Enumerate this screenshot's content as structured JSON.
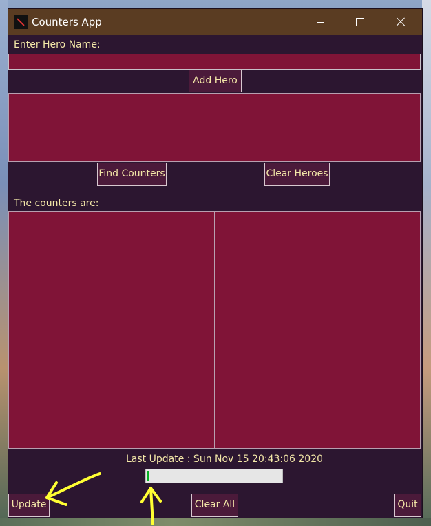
{
  "window": {
    "title": "Counters App"
  },
  "hero_input": {
    "label": "Enter Hero Name:",
    "value": ""
  },
  "buttons": {
    "add_hero": "Add Hero",
    "find_counters": "Find Counters",
    "clear_heroes": "Clear Heroes",
    "update": "Update",
    "clear_all": "Clear All",
    "quit": "Quit"
  },
  "heroes_list": {
    "items": []
  },
  "counters": {
    "label": "The counters are:",
    "left_list": [],
    "right_list": []
  },
  "status": {
    "last_update_text": "Last Update : Sun Nov 15 20:43:06 2020",
    "progress_fraction": 0.01
  },
  "colors": {
    "titlebar": "#5a3c22",
    "background": "#2c1630",
    "list_bg": "#801437",
    "text": "#f3e7a8",
    "button_bg": "#4b1a3a",
    "progress_fill": "#06b025"
  },
  "icons": {
    "app": "dota-logo-icon",
    "minimize": "minimize-icon",
    "maximize": "maximize-icon",
    "close": "close-icon"
  }
}
